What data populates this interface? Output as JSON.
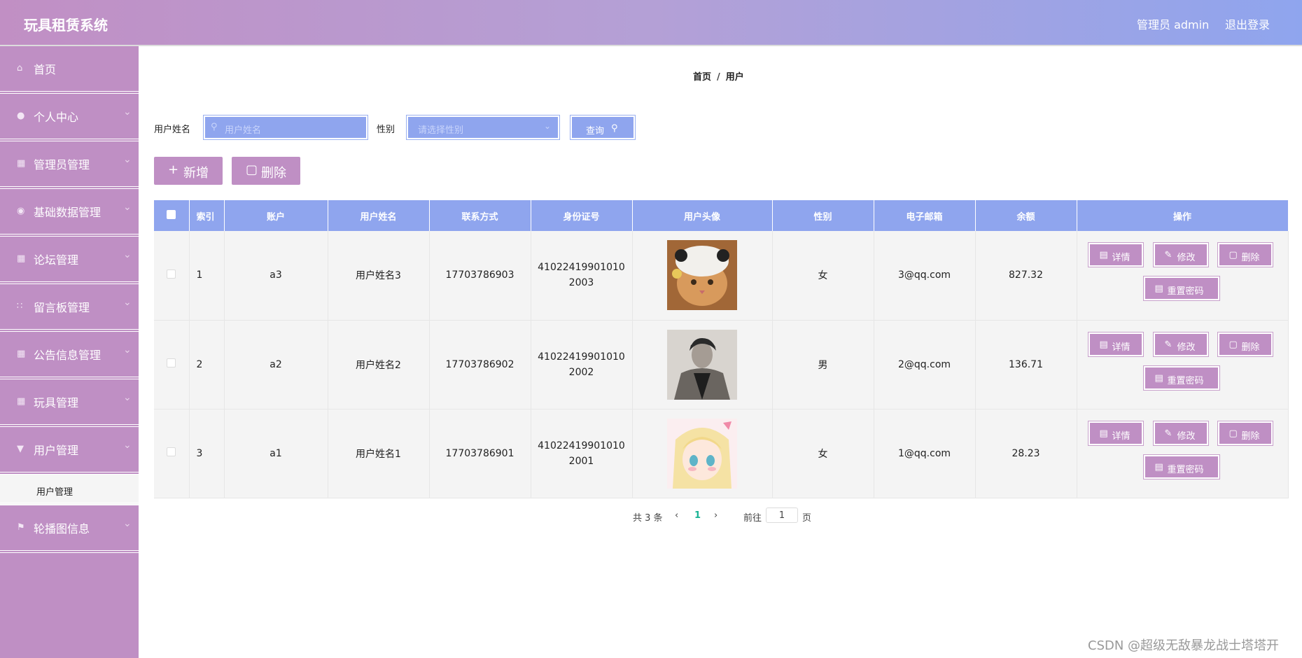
{
  "header": {
    "app_title": "玩具租赁系统",
    "admin_label": "管理员 admin",
    "logout_label": "退出登录"
  },
  "sidebar": {
    "items": [
      {
        "label": "首页",
        "icon": "home-icon"
      },
      {
        "label": "个人中心",
        "icon": "user-icon"
      },
      {
        "label": "管理员管理",
        "icon": "clipboard-icon"
      },
      {
        "label": "基础数据管理",
        "icon": "location-icon"
      },
      {
        "label": "论坛管理",
        "icon": "grid-icon"
      },
      {
        "label": "留言板管理",
        "icon": "grid-dots-icon"
      },
      {
        "label": "公告信息管理",
        "icon": "clipboard-icon"
      },
      {
        "label": "玩具管理",
        "icon": "clipboard-icon"
      },
      {
        "label": "用户管理",
        "icon": "tag-icon"
      },
      {
        "label": "轮播图信息",
        "icon": "flag-icon"
      }
    ],
    "submenu_label": "用户管理"
  },
  "breadcrumb": {
    "home": "首页",
    "sep": "/",
    "current": "用户"
  },
  "search": {
    "name_label": "用户姓名",
    "name_placeholder": "用户姓名",
    "gender_label": "性别",
    "gender_placeholder": "请选择性别",
    "query_label": "查询"
  },
  "actions": {
    "add_label": "新增",
    "delete_label": "删除"
  },
  "table": {
    "headers": [
      "索引",
      "账户",
      "用户姓名",
      "联系方式",
      "身份证号",
      "用户头像",
      "性别",
      "电子邮箱",
      "余额",
      "操作"
    ],
    "rows": [
      {
        "index": "1",
        "account": "a3",
        "name": "用户姓名3",
        "phone": "17703786903",
        "id_card": "410224199010102003",
        "avatar": "cat-photo",
        "gender": "女",
        "email": "3@qq.com",
        "balance": "827.32"
      },
      {
        "index": "2",
        "account": "a2",
        "name": "用户姓名2",
        "phone": "17703786902",
        "id_card": "410224199010102002",
        "avatar": "man-photo",
        "gender": "男",
        "email": "2@qq.com",
        "balance": "136.71"
      },
      {
        "index": "3",
        "account": "a1",
        "name": "用户姓名1",
        "phone": "17703786901",
        "id_card": "410224199010102001",
        "avatar": "anime-girl-photo",
        "gender": "女",
        "email": "1@qq.com",
        "balance": "28.23"
      }
    ],
    "op_labels": {
      "detail": "详情",
      "edit": "修改",
      "delete": "删除",
      "reset": "重置密码"
    }
  },
  "pager": {
    "total_text": "共 3 条",
    "current_page": "1",
    "goto_label": "前往",
    "goto_value": "1",
    "page_unit": "页"
  },
  "watermark": "CSDN @超级无敌暴龙战士塔塔开",
  "colors": {
    "accent_purple": "#bf8fc4",
    "accent_blue": "#8fa5ee"
  }
}
